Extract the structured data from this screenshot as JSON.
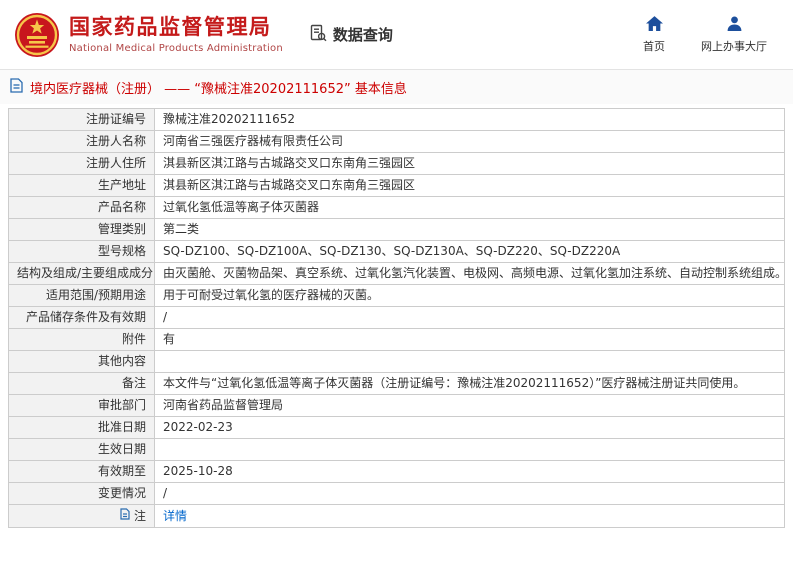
{
  "header": {
    "agency_name_cn": "国家药品监督管理局",
    "agency_name_en": "National Medical Products Administration",
    "section_title": "数据查询",
    "nav_home": "首页",
    "nav_hall": "网上办事大厅"
  },
  "page": {
    "title": "境内医疗器械（注册） —— “豫械注准20202111652” 基本信息"
  },
  "detail_table": {
    "rows": [
      {
        "label": "注册证编号",
        "value": "豫械注准20202111652"
      },
      {
        "label": "注册人名称",
        "value": "河南省三强医疗器械有限责任公司"
      },
      {
        "label": "注册人住所",
        "value": "淇县新区淇江路与古城路交叉口东南角三强园区"
      },
      {
        "label": "生产地址",
        "value": "淇县新区淇江路与古城路交叉口东南角三强园区"
      },
      {
        "label": "产品名称",
        "value": "过氧化氢低温等离子体灭菌器"
      },
      {
        "label": "管理类别",
        "value": "第二类"
      },
      {
        "label": "型号规格",
        "value": "SQ-DZ100、SQ-DZ100A、SQ-DZ130、SQ-DZ130A、SQ-DZ220、SQ-DZ220A"
      },
      {
        "label": "结构及组成/主要组成成分",
        "value": "由灭菌舱、灭菌物品架、真空系统、过氧化氢汽化装置、电极网、高频电源、过氧化氢加注系统、自动控制系统组成。"
      },
      {
        "label": "适用范围/预期用途",
        "value": "用于可耐受过氧化氢的医疗器械的灭菌。"
      },
      {
        "label": "产品储存条件及有效期",
        "value": "/"
      },
      {
        "label": "附件",
        "value": "有"
      },
      {
        "label": "其他内容",
        "value": ""
      },
      {
        "label": "备注",
        "value": "本文件与“过氧化氢低温等离子体灭菌器（注册证编号：豫械注准20202111652）”医疗器械注册证共同使用。"
      },
      {
        "label": "审批部门",
        "value": "河南省药品监督管理局"
      },
      {
        "label": "批准日期",
        "value": "2022-02-23"
      },
      {
        "label": "生效日期",
        "value": ""
      },
      {
        "label": "有效期至",
        "value": "2025-10-28"
      },
      {
        "label": "变更情况",
        "value": "/"
      },
      {
        "label": "注",
        "value": "详情"
      }
    ]
  },
  "colors": {
    "brand_red": "#c41a1a",
    "title_red": "#cc0000",
    "icon_blue": "#1d4f9c",
    "link_blue": "#0066cc",
    "label_bg": "#f2f2f2",
    "border": "#cccccc"
  }
}
